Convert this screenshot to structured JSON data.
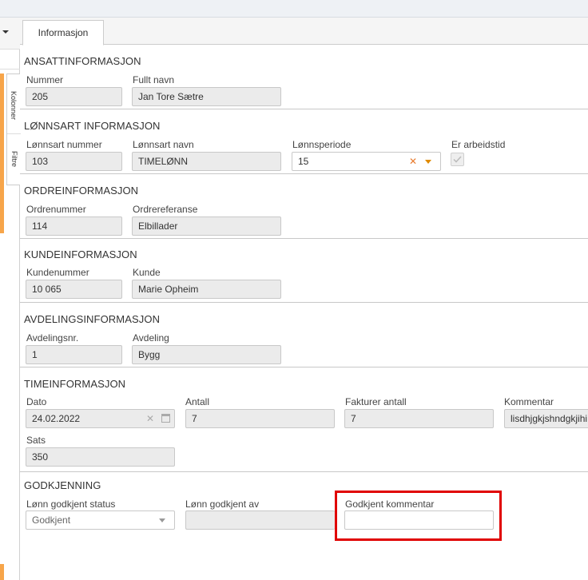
{
  "tab": {
    "label": "Informasjon"
  },
  "side_tabs": {
    "columns": "Kolonner",
    "filter": "Filtre"
  },
  "ansatt": {
    "title": "ANSATTINFORMASJON",
    "number_label": "Nummer",
    "number_value": "205",
    "name_label": "Fullt navn",
    "name_value": "Jan Tore Sætre"
  },
  "lonnsart": {
    "title": "LØNNSART INFORMASJON",
    "number_label": "Lønnsart nummer",
    "number_value": "103",
    "name_label": "Lønnsart navn",
    "name_value": "TIMELØNN",
    "period_label": "Lønnsperiode",
    "period_value": "15",
    "worktime_label": "Er arbeidstid"
  },
  "ordre": {
    "title": "ORDREINFORMASJON",
    "number_label": "Ordrenummer",
    "number_value": "114",
    "ref_label": "Ordrereferanse",
    "ref_value": "Elbillader"
  },
  "kunde": {
    "title": "KUNDEINFORMASJON",
    "number_label": "Kundenummer",
    "number_value": "10 065",
    "name_label": "Kunde",
    "name_value": "Marie Opheim"
  },
  "avdeling": {
    "title": "AVDELINGSINFORMASJON",
    "number_label": "Avdelingsnr.",
    "number_value": "1",
    "name_label": "Avdeling",
    "name_value": "Bygg"
  },
  "time": {
    "title": "TIMEINFORMASJON",
    "date_label": "Dato",
    "date_value": "24.02.2022",
    "count_label": "Antall",
    "count_value": "7",
    "invoice_label": "Fakturer antall",
    "invoice_value": "7",
    "comment_label": "Kommentar",
    "comment_value": "lisdhjgkjshndgkjihi",
    "rate_label": "Sats",
    "rate_value": "350"
  },
  "godkjenning": {
    "title": "GODKJENNING",
    "status_label": "Lønn godkjent status",
    "status_value": "Godkjent",
    "by_label": "Lønn godkjent av",
    "by_value": "",
    "comment_label": "Godkjent kommentar",
    "comment_value": ""
  },
  "colors": {
    "accent": "#f7a54a",
    "highlight": "#e00000"
  }
}
